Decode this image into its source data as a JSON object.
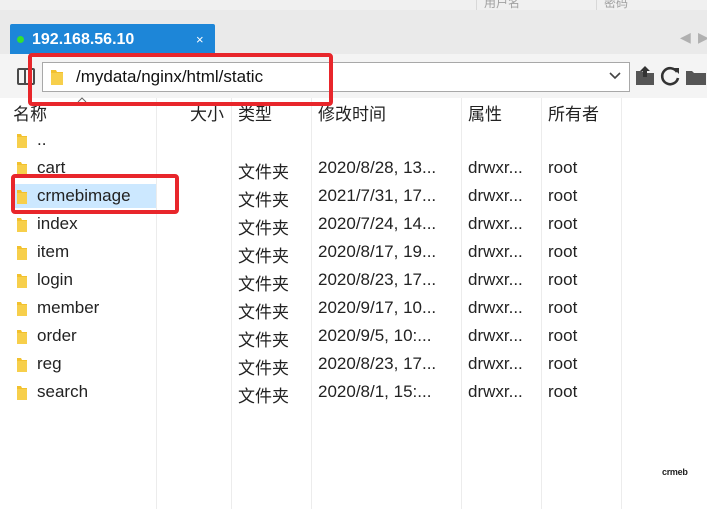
{
  "top_strip": {
    "col1": "用户名",
    "col2": "密码"
  },
  "tab": {
    "title": "192.168.56.10",
    "close": "×"
  },
  "tab_nav": {
    "prev": "◀",
    "next": "▶"
  },
  "address": {
    "path": "/mydata/nginx/html/static"
  },
  "columns": {
    "name": "名称",
    "size": "大小",
    "type": "类型",
    "modified": "修改时间",
    "attrs": "属性",
    "owner": "所有者"
  },
  "rows": [
    {
      "name": "..",
      "size": "",
      "type": "",
      "modified": "",
      "attrs": "",
      "owner": ""
    },
    {
      "name": "cart",
      "size": "",
      "type": "文件夹",
      "modified": "2020/8/28, 13...",
      "attrs": "drwxr...",
      "owner": "root"
    },
    {
      "name": "crmebimage",
      "size": "",
      "type": "文件夹",
      "modified": "2021/7/31, 17...",
      "attrs": "drwxr...",
      "owner": "root",
      "selected": true
    },
    {
      "name": "index",
      "size": "",
      "type": "文件夹",
      "modified": "2020/7/24, 14...",
      "attrs": "drwxr...",
      "owner": "root"
    },
    {
      "name": "item",
      "size": "",
      "type": "文件夹",
      "modified": "2020/8/17, 19...",
      "attrs": "drwxr...",
      "owner": "root"
    },
    {
      "name": "login",
      "size": "",
      "type": "文件夹",
      "modified": "2020/8/23, 17...",
      "attrs": "drwxr...",
      "owner": "root"
    },
    {
      "name": "member",
      "size": "",
      "type": "文件夹",
      "modified": "2020/9/17, 10...",
      "attrs": "drwxr...",
      "owner": "root"
    },
    {
      "name": "order",
      "size": "",
      "type": "文件夹",
      "modified": "2020/9/5, 10:...",
      "attrs": "drwxr...",
      "owner": "root"
    },
    {
      "name": "reg",
      "size": "",
      "type": "文件夹",
      "modified": "2020/8/23, 17...",
      "attrs": "drwxr...",
      "owner": "root"
    },
    {
      "name": "search",
      "size": "",
      "type": "文件夹",
      "modified": "2020/8/1, 15:...",
      "attrs": "drwxr...",
      "owner": "root"
    }
  ],
  "icons": {
    "folder": "folder-icon",
    "panel": "panel-toggle-icon",
    "chevron": "chevron-down-icon",
    "up": "folder-up-icon",
    "refresh": "refresh-icon"
  },
  "colors": {
    "tab": "#1d86d8",
    "selection": "#cce8ff",
    "annotation": "#e8262b",
    "folder": "#f2c12e"
  },
  "watermark": "crmeb"
}
